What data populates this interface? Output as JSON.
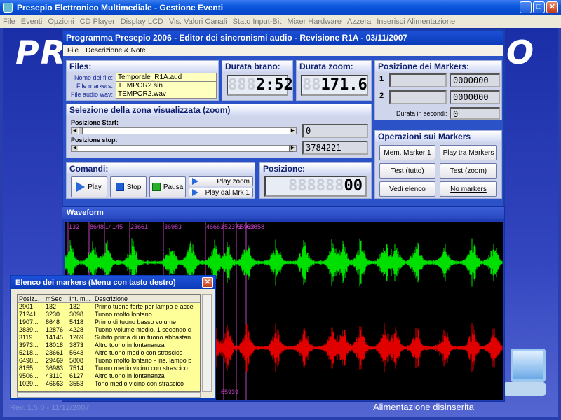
{
  "window": {
    "title": "Presepio Elettronico Multimediale - Gestione Eventi"
  },
  "menubar": [
    "File",
    "Eventi",
    "Opzioni",
    "CD Player",
    "Display LCD",
    "Vis. Valori Canali",
    "Stato Input-Bit",
    "Mixer Hardware",
    "Azzera",
    "Inserisci Alimentazione"
  ],
  "background": {
    "logo_left": "PR",
    "logo_right": "O",
    "revision": "Rev. 1.5.0 - 11/12/2007",
    "power_status": "Alimentazione disinserita"
  },
  "editor": {
    "title": "Programma Presepio 2006 - Editor dei sincronismi audio - Revisione R1A - 03/11/2007",
    "menu": [
      "File",
      "Descrizione & Note"
    ],
    "files": {
      "header": "Files:",
      "name_label": "Nome del file:",
      "name_value": "Temporale_R1A.aud",
      "markers_label": "File markers:",
      "markers_value": "TEMPOR2.sin",
      "wav_label": "File audio wav:",
      "wav_value": "TEMPOR2.wav"
    },
    "durata_brano": {
      "header": "Durata brano:",
      "ghost": "888",
      "value": "2:52"
    },
    "durata_zoom": {
      "header": "Durata zoom:",
      "ghost": "88",
      "value": "171.6"
    },
    "zona": {
      "header": "Selezione della zona visualizzata (zoom)",
      "start_label": "Posizione Start:",
      "start_value": "0",
      "stop_label": "Posizione stop:",
      "stop_value": "3784221"
    },
    "comandi": {
      "header": "Comandi:",
      "play": "Play",
      "stop": "Stop",
      "pausa": "Pausa",
      "play_zoom": "Play zoom",
      "play_dal_mrk": "Play dal Mrk 1"
    },
    "posizione": {
      "header": "Posizione:",
      "ghost": "888888",
      "value": "00"
    },
    "markers_pos": {
      "header": "Posizione dei Markers:",
      "m1_label": "1",
      "m1_value": "0000000",
      "m2_label": "2",
      "m2_value": "0000000",
      "durata_label": "Durata in secondi:",
      "durata_value": "0"
    },
    "operazioni": {
      "header": "Operazioni sui Markers",
      "mem_marker": "Mem. Marker 1",
      "play_tra": "Play tra Markers",
      "test_tutto": "Test (tutto)",
      "test_zoom": "Test (zoom)",
      "vedi_elenco": "Vedi elenco",
      "no_markers": "No markers"
    }
  },
  "waveform": {
    "header": "Waveform",
    "marker_labels": [
      "132",
      "8648",
      "14145",
      "23661",
      "36983",
      "46663",
      "52371",
      "62858",
      "65939"
    ],
    "bottom_label": "65939",
    "colors": {
      "top": "#00e000",
      "bottom": "#e00000",
      "markers": "#c040c0"
    }
  },
  "markers_list": {
    "title": "Elenco dei markers (Menu con tasto destro)",
    "columns": [
      "Posiz...",
      "mSec",
      "Int. m...",
      "Descrizione"
    ],
    "rows": [
      [
        "2901",
        "132",
        "132",
        "Primo tuono forte per lampo e acce"
      ],
      [
        "71241",
        "3230",
        "3098",
        "Tuono molto lontano"
      ],
      [
        "1907...",
        "8648",
        "5418",
        "Primo di tuono basso volume"
      ],
      [
        "2839...",
        "12876",
        "4228",
        "Tuono volume medio. 1 secondo c"
      ],
      [
        "3119...",
        "14145",
        "1269",
        "Subito prima di un tuono abbastan"
      ],
      [
        "3973...",
        "18018",
        "3873",
        "Altro tuono in lontananza"
      ],
      [
        "5218...",
        "23661",
        "5643",
        "Altro tuono medio con strascico"
      ],
      [
        "6498...",
        "29469",
        "5808",
        "Tuono molto lontano - ins. lampo b"
      ],
      [
        "8155...",
        "36983",
        "7514",
        "Tuono medio vicino con strascico"
      ],
      [
        "9506...",
        "43110",
        "6127",
        "Altro tuono in lontananza"
      ],
      [
        "1029...",
        "46663",
        "3553",
        "Tono medio vicino con strascico"
      ]
    ]
  }
}
